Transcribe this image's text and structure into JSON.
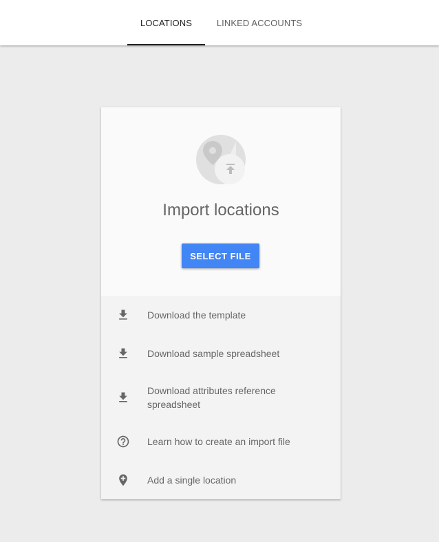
{
  "tabs": [
    {
      "label": "LOCATIONS",
      "active": true
    },
    {
      "label": "LINKED ACCOUNTS",
      "active": false
    }
  ],
  "card": {
    "title": "Import locations",
    "hero_icon": "location-upload-icon",
    "select_button": "SELECT FILE",
    "actions": [
      {
        "label": "Download the template",
        "icon": "download-icon"
      },
      {
        "label": "Download sample spreadsheet",
        "icon": "download-icon"
      },
      {
        "label": "Download attributes reference spreadsheet",
        "icon": "download-icon"
      },
      {
        "label": "Learn how to create an import file",
        "icon": "help-circle-icon"
      },
      {
        "label": "Add a single location",
        "icon": "add-location-icon"
      }
    ]
  },
  "colors": {
    "accent": "#4285f4",
    "background": "#ececec",
    "text_secondary": "#666666"
  }
}
